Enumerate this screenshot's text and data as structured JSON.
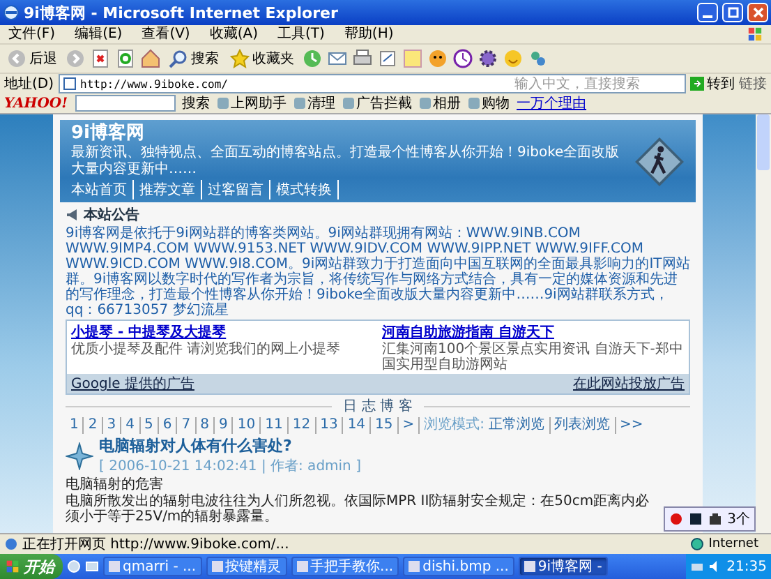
{
  "window": {
    "title": "9i博客网 - Microsoft Internet Explorer"
  },
  "menu": [
    "文件(F)",
    "编辑(E)",
    "查看(V)",
    "收藏(A)",
    "工具(T)",
    "帮助(H)"
  ],
  "toolbar": {
    "back": "后退",
    "search": "搜索",
    "favorites": "收藏夹"
  },
  "address_bar": {
    "label": "地址(D)",
    "url": "http://www.9iboke.com/",
    "search_placeholder": "输入中文，直接搜索",
    "go": "转到",
    "links": "链接"
  },
  "yahoo_bar": {
    "logo": "YAHOO!",
    "search": "搜索",
    "items": [
      "上网助手",
      "清理",
      "广告拦截",
      "相册",
      "购物"
    ],
    "link": "一万个理由"
  },
  "page": {
    "site_title": "9i博客网",
    "slogan": "最新资讯、独特视点、全面互动的博客站点。打造最个性博客从你开始！9iboke全面改版大量内容更新中……",
    "nav": [
      "本站首页",
      "推荐文章",
      "过客留言",
      "模式转换"
    ],
    "announcement": {
      "title": "本站公告",
      "text": "9i博客网是依托于9i网站群的博客类网站。9i网站群现拥有网站：WWW.9INB.COM WWW.9IMP4.COM WWW.9153.NET WWW.9IDV.COM WWW.9IPP.NET WWW.9IFF.COM WWW.9ICD.COM WWW.9I8.COM。9i网站群致力于打造面向中国互联网的全面最具影响力的IT网站群。9i博客网以数字时代的写作者为宗旨，将传统写作与网络方式结合，具有一定的媒体资源和先进的写作理念，打造最个性博客从你开始！9iboke全面改版大量内容更新中……9i网站群联系方式，qq：66713057 梦幻流星"
    },
    "ads": [
      {
        "title": "小提琴 - 中提琴及大提琴",
        "desc": "优质小提琴及配件 请浏览我们的网上小提琴"
      },
      {
        "title": "河南自助旅游指南 自游天下",
        "desc": "汇集河南100个景区景点实用资讯 自游天下-郑中国实用型自助游网站"
      }
    ],
    "ads_footer": {
      "left": "Google 提供的广告",
      "right": "在此网站投放广告"
    },
    "section_title": "日 志 博 客",
    "pagination": {
      "pages": [
        "1",
        "2",
        "3",
        "4",
        "5",
        "6",
        "7",
        "8",
        "9",
        "10",
        "11",
        "12",
        "13",
        "14",
        "15"
      ],
      "next": ">",
      "mode_label": "浏览模式:",
      "modes": [
        "正常浏览",
        "列表浏览"
      ],
      "more": ">>"
    },
    "post": {
      "title": "电脑辐射对人体有什么害处?",
      "meta": "[ 2006-10-21 14:02:41 | 作者: admin ]",
      "subtitle": "电脑辐射的危害",
      "paragraphs": [
        "电脑所散发出的辐射电波往往为人们所忽视。依国际MPR II防辐射安全规定：在50cm距离内必须小于等于25V/m的辐射暴露量。"
      ]
    }
  },
  "popup_toolbar": {
    "text": "3个"
  },
  "status_bar": {
    "text": "正在打开网页 http://www.9iboke.com/...",
    "zone": "Internet"
  },
  "taskbar": {
    "start": "开始",
    "tasks": [
      {
        "label": "qmarri - ...",
        "selected": false
      },
      {
        "label": "按键精灵",
        "selected": false
      },
      {
        "label": "手把手教你...",
        "selected": false
      },
      {
        "label": "dishi.bmp ...",
        "selected": false
      },
      {
        "label": "9i博客网 -",
        "selected": true
      }
    ],
    "clock": "21:35"
  }
}
